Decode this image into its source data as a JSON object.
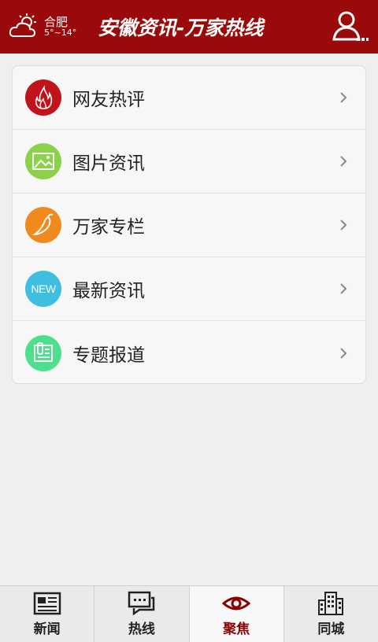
{
  "header": {
    "title": "安徽资讯-万家热线",
    "weather": {
      "city": "合肥",
      "temperature": "5°~14°",
      "icon": "partly-cloudy-icon"
    },
    "user_icon": "user-menu-icon",
    "bg_color": "#9a0a0a"
  },
  "menu": {
    "items": [
      {
        "label": "网友热评",
        "icon": "flame-icon",
        "color": "#c0141a"
      },
      {
        "label": "图片资讯",
        "icon": "picture-icon",
        "color": "#8cd14a"
      },
      {
        "label": "万家专栏",
        "icon": "pepper-icon",
        "color": "#f08a1e"
      },
      {
        "label": "最新资讯",
        "icon": "new-icon",
        "icon_text": "NEW",
        "color": "#3fbfe0"
      },
      {
        "label": "专题报道",
        "icon": "clipboard-icon",
        "color": "#4de08c"
      }
    ]
  },
  "tabs": [
    {
      "label": "新闻",
      "icon": "newspaper-icon",
      "active": false
    },
    {
      "label": "热线",
      "icon": "chat-icon",
      "active": false
    },
    {
      "label": "聚焦",
      "icon": "eye-icon",
      "active": true
    },
    {
      "label": "同城",
      "icon": "buildings-icon",
      "active": false
    }
  ],
  "colors": {
    "accent": "#8a0000",
    "background": "#eef0f0"
  }
}
